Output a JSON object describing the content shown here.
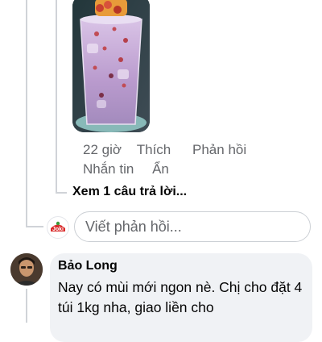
{
  "comment_actions": {
    "time": "22 giờ",
    "like": "Thích",
    "reply": "Phản hồi",
    "message": "Nhắn tin",
    "hide": "Ẩn"
  },
  "view_replies": "Xem 1 câu trả lời...",
  "reply_composer": {
    "placeholder": "Viết phản hồi...",
    "avatar_logo": "Joki"
  },
  "comment": {
    "author": "Bảo Long",
    "text": "Nay có mùi mới ngon nè. Chị cho đặt 4 túi 1kg nha, giao liền cho"
  },
  "colors": {
    "muted_text": "#65676b",
    "bubble_bg": "#f0f2f5",
    "drink_purple": "#c8a6d8"
  }
}
